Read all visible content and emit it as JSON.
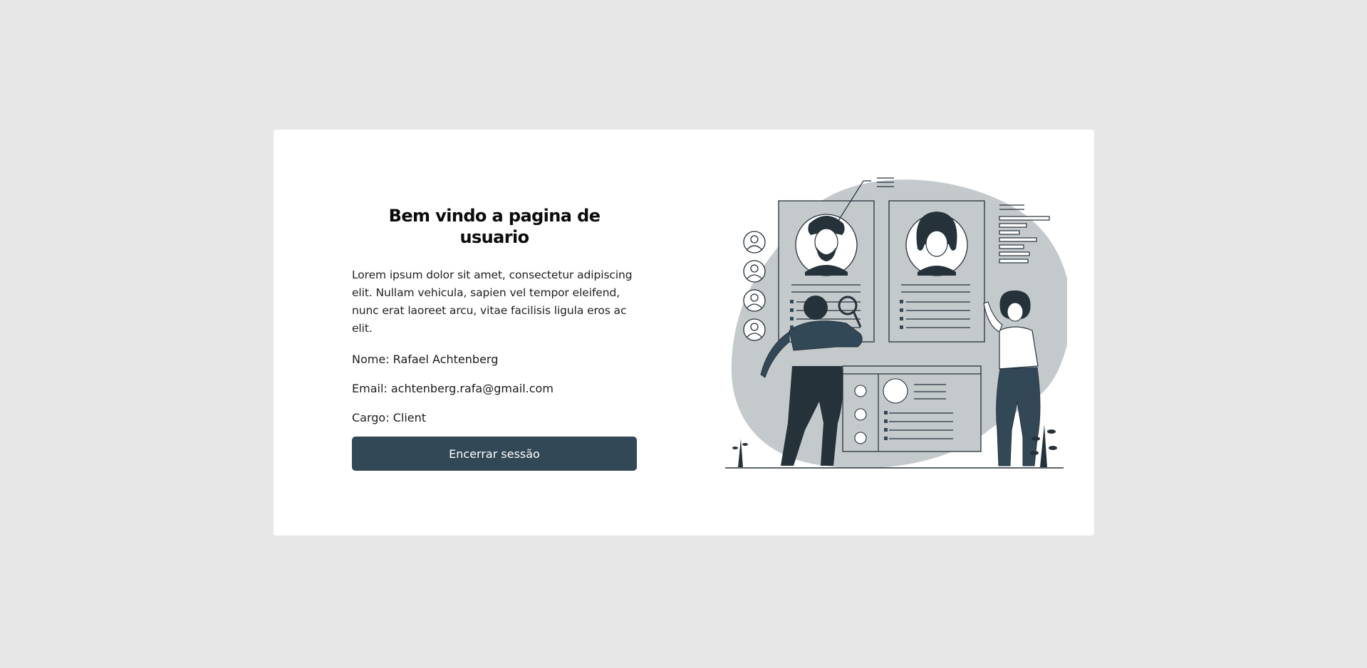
{
  "card": {
    "title": "Bem vindo a pagina de usuario",
    "intro": "Lorem ipsum dolor sit amet, consectetur adipiscing elit. Nullam vehicula, sapien vel tempor eleifend, nunc erat laoreet arcu, vitae facilisis ligula eros ac elit.",
    "fields": [
      {
        "label": "Nome:",
        "value": "Rafael Achtenberg"
      },
      {
        "label": "Email:",
        "value": "achtenberg.rafa@gmail.com"
      },
      {
        "label": "Cargo:",
        "value": "Client"
      }
    ],
    "logout_label": "Encerrar sessão"
  },
  "illustration": {
    "name": "profile-review-illustration"
  },
  "colors": {
    "background": "#e7e7e7",
    "card": "#ffffff",
    "accent": "#324857",
    "blob": "#c4c9cc",
    "ink": "#26323a"
  }
}
